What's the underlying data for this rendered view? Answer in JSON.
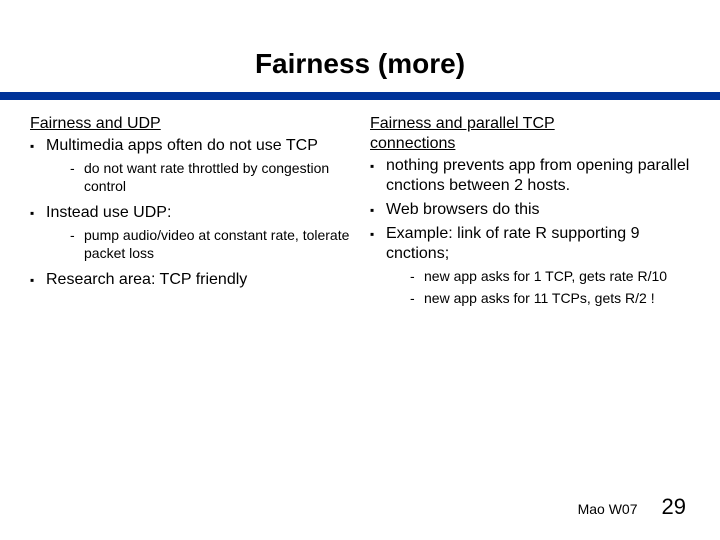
{
  "title": "Fairness (more)",
  "left": {
    "heading": "Fairness and UDP",
    "items": [
      {
        "text": "Multimedia apps often do not use TCP",
        "sub": [
          "do not want rate throttled by congestion control"
        ]
      },
      {
        "text": "Instead use UDP:",
        "sub": [
          "pump audio/video at constant rate, tolerate packet loss"
        ]
      },
      {
        "text": "Research area: TCP friendly"
      }
    ]
  },
  "right": {
    "heading_l1": "Fairness and parallel TCP",
    "heading_l2": "connections",
    "items": [
      {
        "text": "nothing prevents app from opening parallel cnctions between 2 hosts."
      },
      {
        "text": "Web browsers do this"
      },
      {
        "text": "Example: link of rate R supporting 9 cnctions;",
        "sub": [
          "new app asks for 1 TCP, gets rate R/10",
          "new app asks for 11 TCPs, gets R/2 !"
        ]
      }
    ]
  },
  "footer": {
    "text": "Mao W07",
    "page": "29"
  }
}
